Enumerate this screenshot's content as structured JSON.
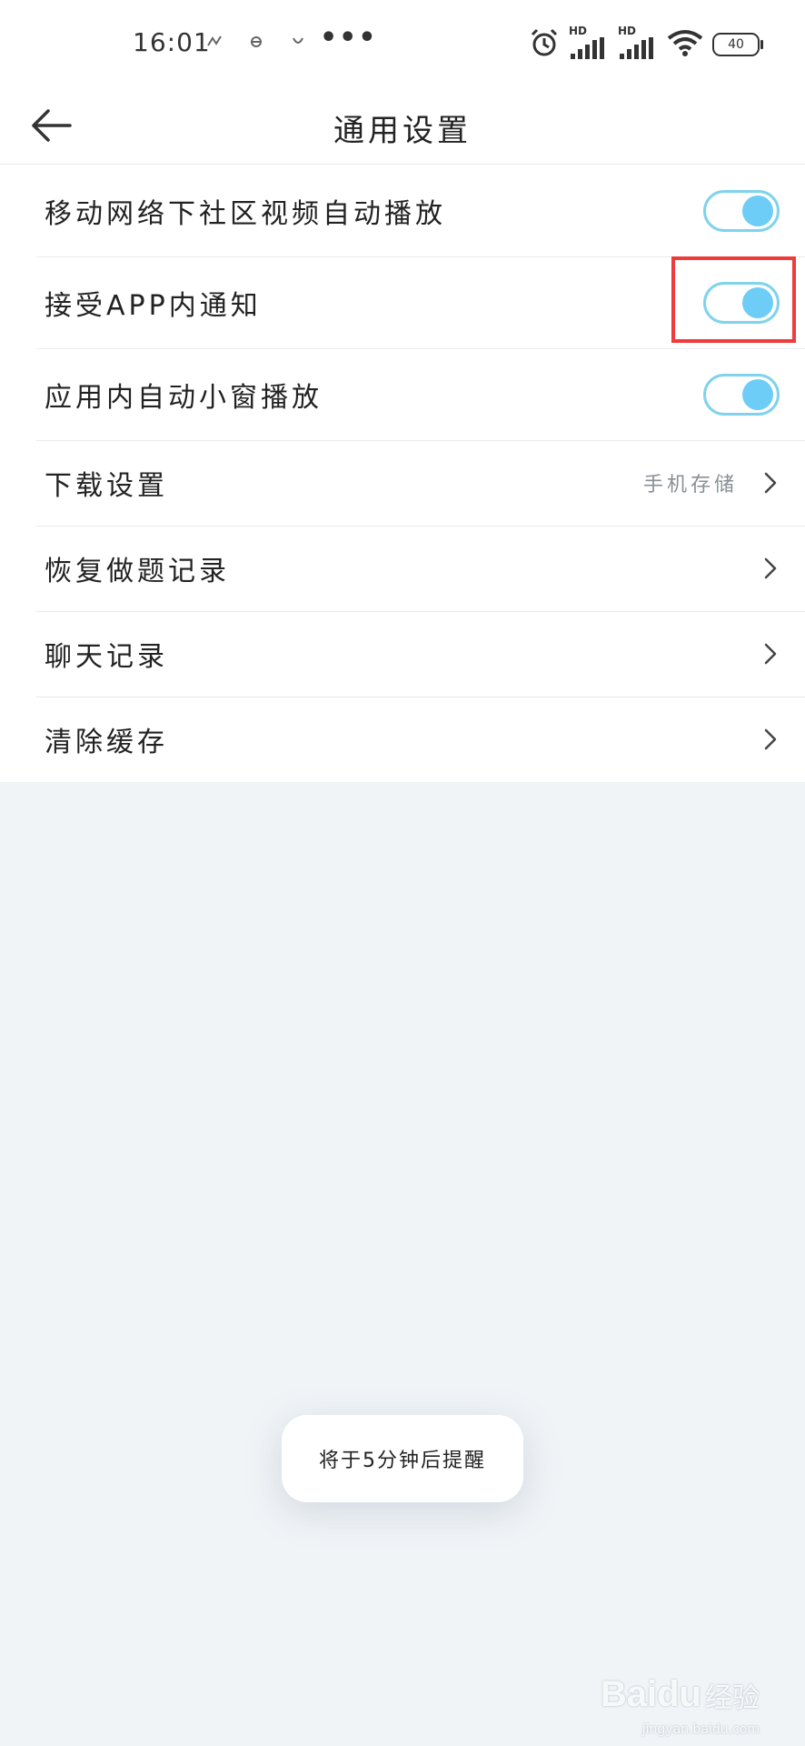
{
  "status_bar": {
    "time": "16:01",
    "dots": "•••",
    "signal_1_label": "HD",
    "signal_2_label": "HD",
    "battery": "40"
  },
  "header": {
    "title": "通用设置"
  },
  "settings": {
    "items": [
      {
        "label": "移动网络下社区视频自动播放",
        "type": "toggle",
        "on": true
      },
      {
        "label": "接受APP内通知",
        "type": "toggle",
        "on": true
      },
      {
        "label": "应用内自动小窗播放",
        "type": "toggle",
        "on": true
      },
      {
        "label": "下载设置",
        "type": "nav",
        "value": "手机存储"
      },
      {
        "label": "恢复做题记录",
        "type": "nav"
      },
      {
        "label": "聊天记录",
        "type": "nav"
      },
      {
        "label": "清除缓存",
        "type": "nav"
      }
    ]
  },
  "toast": {
    "message": "将于5分钟后提醒"
  },
  "watermark": {
    "brand": "Baidu",
    "sub": "经验",
    "url": "jingyan.baidu.com"
  },
  "colors": {
    "toggle_knob": "#6dcdf6",
    "toggle_border": "#7fd3ec",
    "highlight": "#ef3b3b",
    "page_background": "#f0f4f7"
  }
}
